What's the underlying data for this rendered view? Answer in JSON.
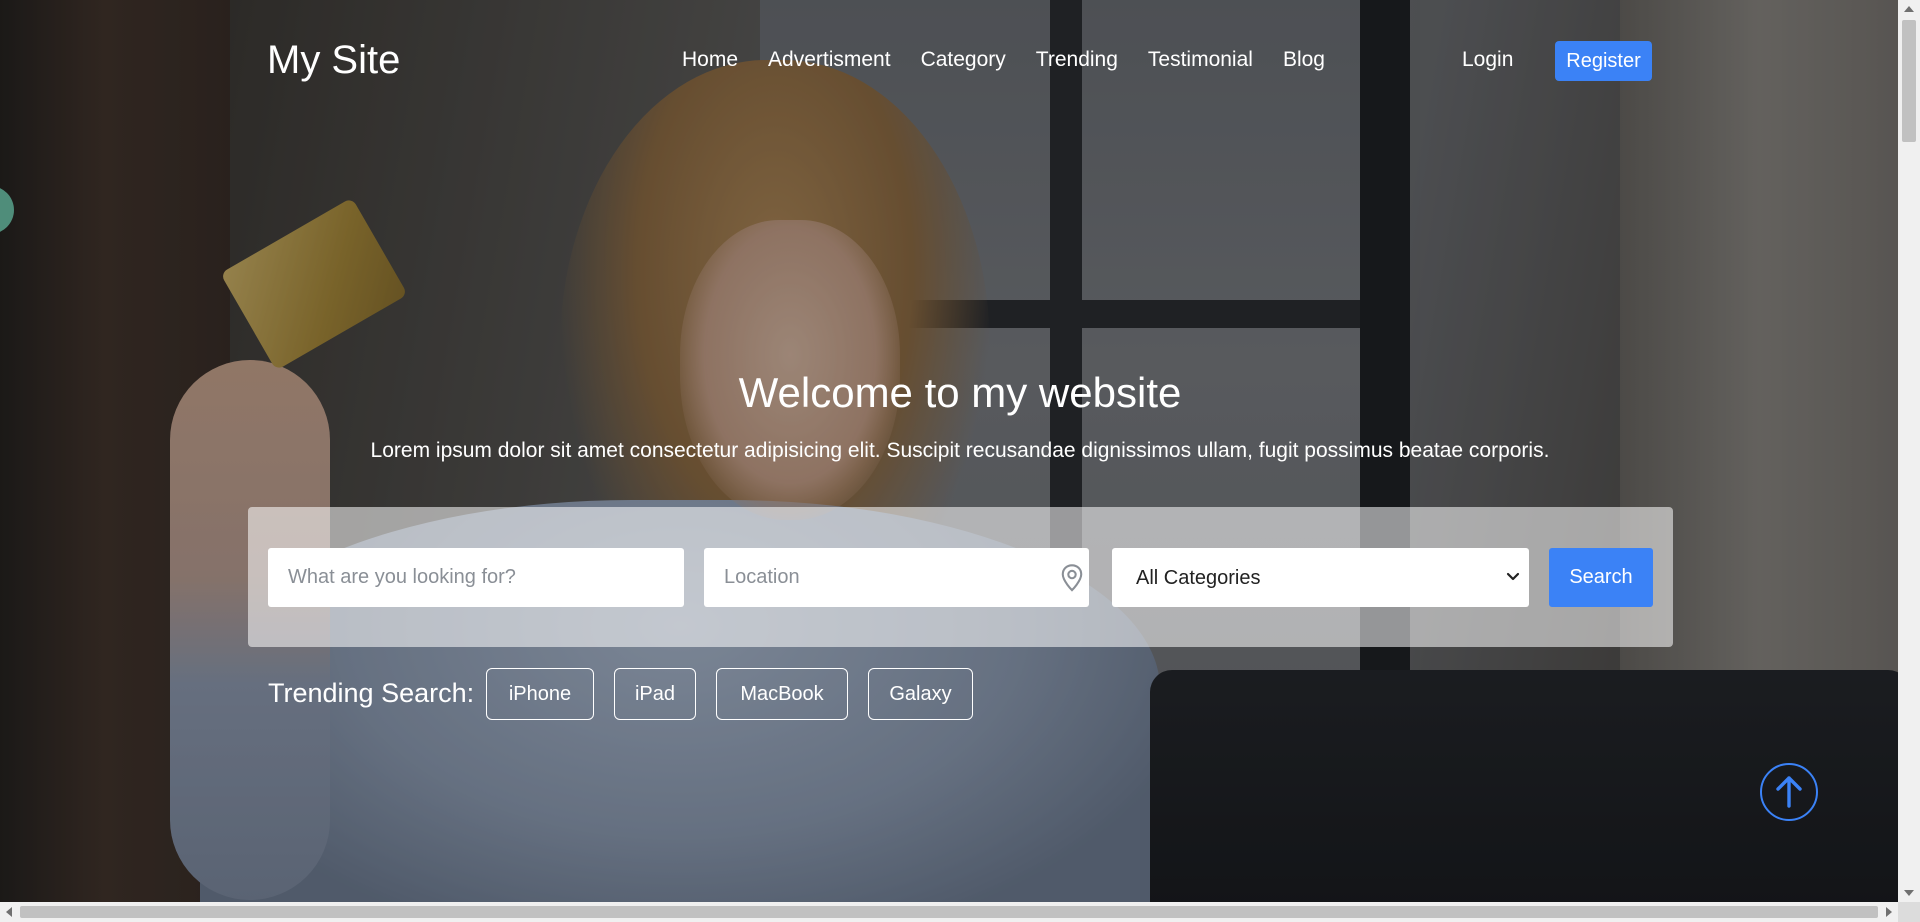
{
  "header": {
    "brand": "My Site",
    "nav": [
      "Home",
      "Advertisment",
      "Category",
      "Trending",
      "Testimonial",
      "Blog"
    ],
    "login_label": "Login",
    "register_label": "Register"
  },
  "hero": {
    "title": "Welcome to my website",
    "subtitle": "Lorem ipsum dolor sit amet consectetur adipisicing elit. Suscipit recusandae dignissimos ullam, fugit possimus beatae corporis."
  },
  "search": {
    "query_placeholder": "What are you looking for?",
    "location_placeholder": "Location",
    "location_icon": "map-pin-icon",
    "category_selected": "All Categories",
    "button_label": "Search"
  },
  "trending": {
    "label": "Trending Search:",
    "items": [
      "iPhone",
      "iPad",
      "MacBook",
      "Galaxy"
    ]
  },
  "floating": {
    "back_to_top_icon": "arrow-up-icon"
  },
  "colors": {
    "accent": "#3b82f6",
    "text_on_hero": "#ffffff",
    "side_tab": "#4f8d7a"
  }
}
